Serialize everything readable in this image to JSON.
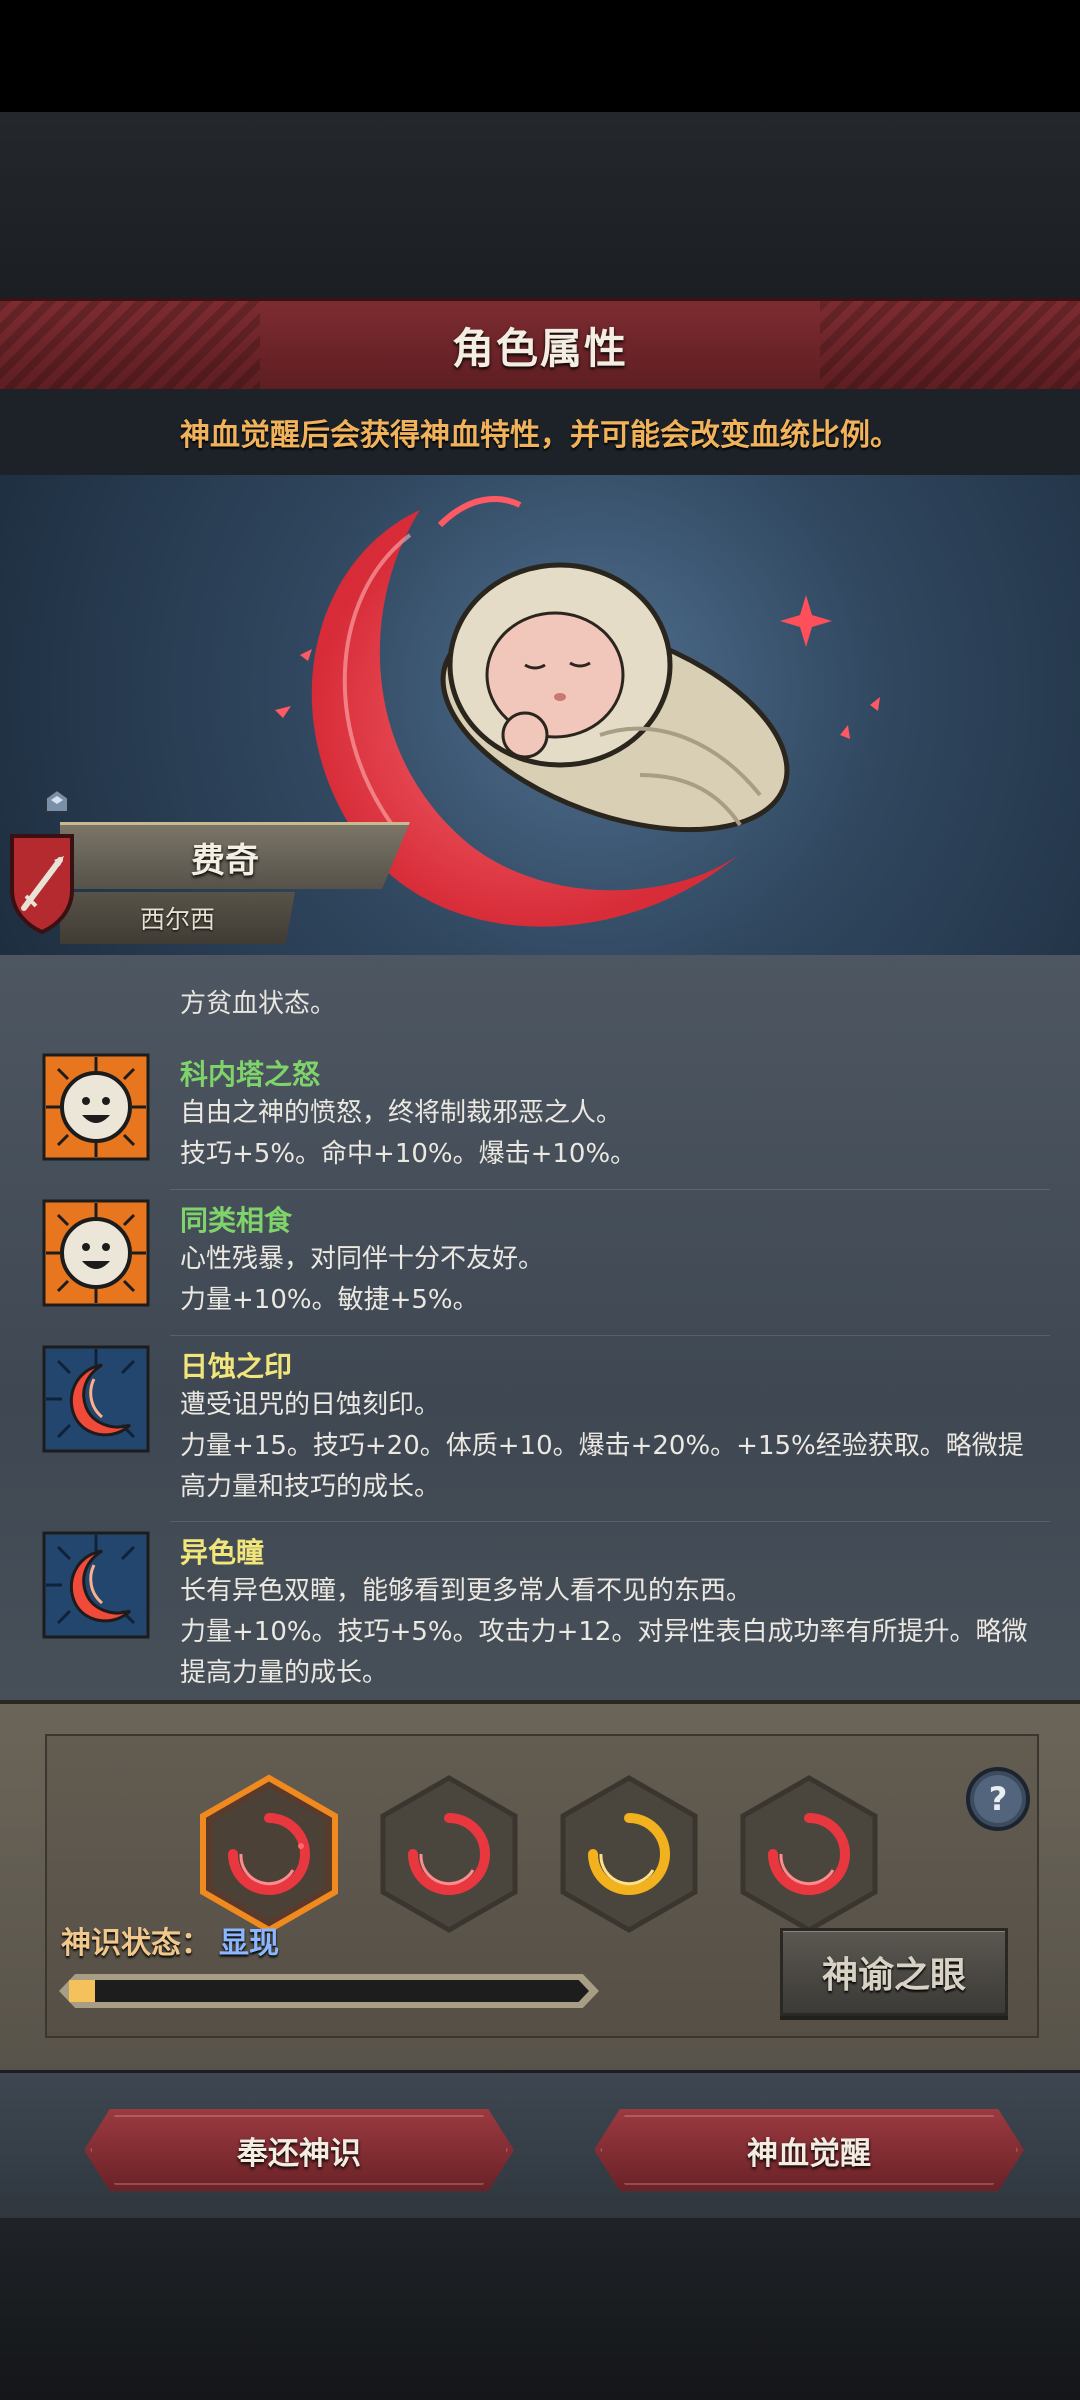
{
  "header": {
    "title": "角色属性",
    "subtitle": "神血觉醒后会获得神血特性，并可能会改变血统比例。"
  },
  "character": {
    "name": "费奇",
    "sub_name": "西尔西"
  },
  "traits": {
    "clipped_text": "方贫血状态。",
    "items": [
      {
        "name": "科内塔之怒",
        "color": "#7fd36b",
        "icon": "smiley-face-icon",
        "desc1": "自由之神的愤怒，终将制裁邪恶之人。",
        "desc2": "技巧+5%。命中+10%。爆击+10%。"
      },
      {
        "name": "同类相食",
        "color": "#7fd36b",
        "icon": "smiley-face-icon",
        "desc1": "心性残暴，对同伴十分不友好。",
        "desc2": "力量+10%。敏捷+5%。"
      },
      {
        "name": "日蚀之印",
        "color": "#f2e67a",
        "icon": "crescent-moon-icon",
        "desc1": "遭受诅咒的日蚀刻印。",
        "desc2": "力量+15。技巧+20。体质+10。爆击+20%。+15%经验获取。略微提高力量和技巧的成长。"
      },
      {
        "name": "异色瞳",
        "color": "#f2e67a",
        "icon": "crescent-moon-icon",
        "desc1": "长有异色双瞳，能够看到更多常人看不见的东西。",
        "desc2": "力量+10%。技巧+5%。攻击力+12。对异性表白成功率有所提升。略微提高力量的成长。"
      }
    ]
  },
  "divine_panel": {
    "slots": [
      {
        "icon": "red-crescent-icon",
        "selected": true
      },
      {
        "icon": "red-crescent-icon",
        "selected": false
      },
      {
        "icon": "gold-crescent-icon",
        "selected": false
      },
      {
        "icon": "red-crescent-icon",
        "selected": false
      }
    ],
    "state_label": "神识状态：",
    "state_value": "显现",
    "progress": 0.05,
    "eye_button": "神谕之眼"
  },
  "buttons": {
    "return_label": "奉还神识",
    "awaken_label": "神血觉醒"
  },
  "colors": {
    "accent_red": "#7d2c31",
    "subtitle_orange": "#f0b25a",
    "trait_green": "#7fd36b",
    "trait_yellow": "#f2e67a",
    "progress_fill": "#f5c15a"
  }
}
